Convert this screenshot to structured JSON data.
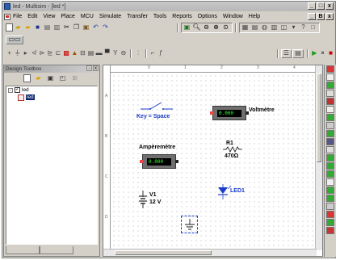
{
  "window": {
    "title": "led - Multisim - [led *]",
    "controls": [
      "_",
      "□",
      "x"
    ],
    "mdi_controls": [
      "_",
      "B",
      "x"
    ]
  },
  "menu": [
    "File",
    "Edit",
    "View",
    "Place",
    "MCU",
    "Simulate",
    "Transfer",
    "Tools",
    "Reports",
    "Options",
    "Window",
    "Help"
  ],
  "toolbar": {
    "row1_left_icons": [
      "new-icon",
      "open-icon",
      "open-folder-icon",
      "save-icon",
      "print-icon",
      "print-preview-icon",
      "cut-icon",
      "copy-icon",
      "paste-icon",
      "undo-icon",
      "redo-icon"
    ],
    "row1_mid_icons": [
      "fullscreen-icon",
      "zoom-in-icon",
      "zoom-out-icon",
      "zoom-area-icon",
      "zoom-fit-icon"
    ],
    "row1_right_icons": [
      "design-toolbox-icon",
      "spreadsheet-icon",
      "database-icon",
      "postprocessor-icon",
      "grapher-icon",
      "list-icon",
      "help-icon",
      "box-icon"
    ],
    "row2_icons": [
      "sim-icon"
    ],
    "row3_icons": [
      "source-icon",
      "basic-icon",
      "diode-icon",
      "transistor-icon",
      "analog-icon",
      "ttl-icon",
      "cmos-icon",
      "misc-digital-icon",
      "mixed-icon",
      "indicator-icon",
      "power-icon",
      "misc-icon",
      "rf-icon",
      "electromech-icon",
      "mcu-icon",
      "hierarchical-icon",
      "bus-icon"
    ],
    "sim_controls": [
      "run-icon",
      "pause-icon",
      "stop-icon"
    ]
  },
  "design_toolbox": {
    "title": "Design Toolbox",
    "panel_buttons": [
      "-",
      "x"
    ],
    "tree": [
      {
        "label": "led",
        "expander": "-"
      },
      {
        "label": "led"
      }
    ]
  },
  "schematic": {
    "ruler_top": [
      "0",
      "1",
      "2",
      "3",
      "4"
    ],
    "ruler_left": [
      "A",
      "B",
      "C",
      "D"
    ],
    "components": {
      "switch": {
        "label": "Key = Space"
      },
      "voltmeter": {
        "label": "Voltmètre",
        "reading": "0.000"
      },
      "ammeter": {
        "label": "Ampèremètre",
        "reading": "0.000"
      },
      "resistor": {
        "ref": "R1",
        "value": "470Ω"
      },
      "battery": {
        "ref": "V1",
        "value": "12 V"
      },
      "led": {
        "ref": "LED1"
      }
    }
  }
}
